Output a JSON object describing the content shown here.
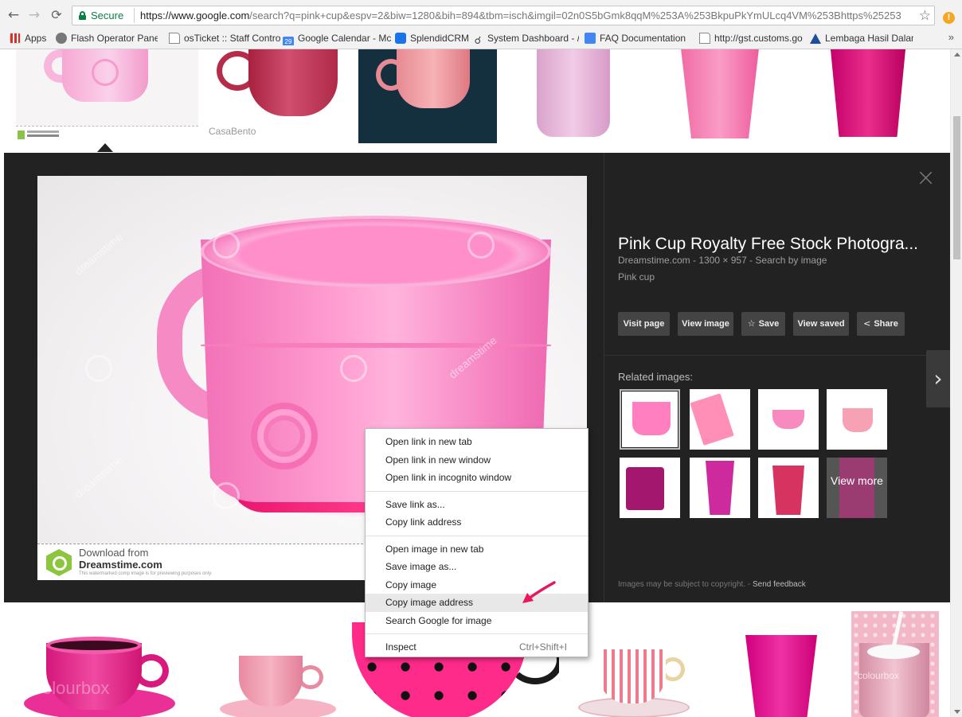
{
  "browser": {
    "secure_label": "Secure",
    "url_host": "https://www.google.com",
    "url_rest": "/search?q=pink+cup&espv=2&biw=1280&bih=894&tbm=isch&imgil=02n0S5bGmk8qqM%253A%253BkpuPkYmULcq4VM%253Bhttps%25253",
    "bookmarks": [
      "Apps",
      "Flash Operator Panel",
      "osTicket :: Staff Contro",
      "Google Calendar - Mc",
      "SplendidCRM",
      "System Dashboard - /",
      "FAQ Documentation",
      "http://gst.customs.go",
      "Lembaga Hasil Dalam"
    ],
    "bookmarks_overflow": "»",
    "calendar_badge": "29",
    "extension_badge": "!"
  },
  "top_row": {
    "thumb2_brand": "CasaBento"
  },
  "viewer": {
    "title": "Pink Cup Royalty Free Stock Photogra...",
    "meta": "Dreamstime.com  -  1300 × 957  -  Search by image",
    "description": "Pink cup",
    "image_footer": {
      "download_from": "Download from",
      "site": "Dreamstime.com",
      "note": "This watermarked comp image is for previewing purposes only."
    },
    "watermark": "dreamstime",
    "actions": {
      "visit": "Visit page",
      "view": "View image",
      "save": "Save",
      "saved": "View saved",
      "share": "Share"
    },
    "related_label": "Related images:",
    "view_more": "View more",
    "copyright": "Images may be subject to copyright.",
    "feedback": "Send feedback",
    "close": "×",
    "next": "›"
  },
  "bottom_row": {
    "watermark1": "colourbox",
    "watermark6": "colourbox"
  },
  "context_menu": {
    "groups": [
      [
        "Open link in new tab",
        "Open link in new window",
        "Open link in incognito window"
      ],
      [
        "Save link as...",
        "Copy link address"
      ],
      [
        "Open image in new tab",
        "Save image as...",
        "Copy image",
        "Copy image address",
        "Search Google for image"
      ],
      [
        "Inspect"
      ]
    ],
    "inspect_shortcut": "Ctrl+Shift+I",
    "highlighted": "Copy image address"
  },
  "colors": {
    "viewer_bg": "#222222",
    "accent_pink": "#e8146e",
    "annotation_arrow": "#e8175d"
  }
}
